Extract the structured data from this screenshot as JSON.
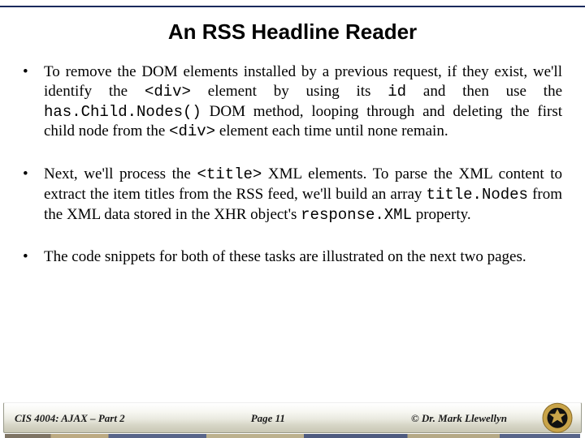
{
  "title": "An RSS Headline Reader",
  "bullets": {
    "b1": {
      "p1": "To remove the DOM elements installed by a previous request, if they exist, we'll identify the ",
      "c1": "<div>",
      "p2": " element by using its ",
      "c2": "id",
      "p3": " and then use the ",
      "c3": "has.Child.Nodes()",
      "p4": " DOM method, looping through and deleting the first child node from the ",
      "c4": "<div>",
      "p5": " element each time until none remain."
    },
    "b2": {
      "p1": "Next, we'll process the ",
      "c1": "<title>",
      "p2": " XML elements.  To parse the XML content to extract the item titles from the RSS feed, we'll build an array ",
      "c2": "title.Nodes",
      "p3": " from the XML data stored in the XHR object's ",
      "c3": "response.XML",
      "p4": " property."
    },
    "b3": {
      "p1": "The code snippets for both of these tasks are illustrated on the next two pages."
    }
  },
  "footer": {
    "course": "CIS 4004: AJAX – Part 2",
    "page": "Page 11",
    "author": "© Dr. Mark Llewellyn"
  }
}
